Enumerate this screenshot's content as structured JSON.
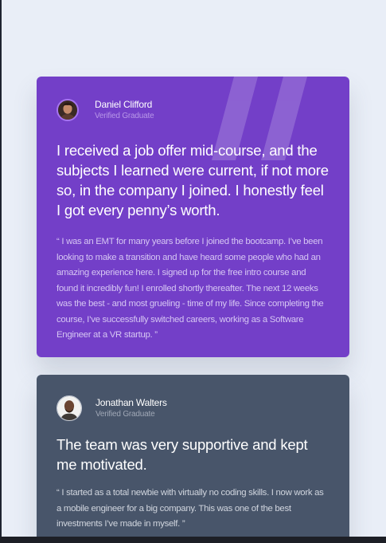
{
  "testimonials": [
    {
      "name": "Daniel Clifford",
      "role": "Verified Graduate",
      "headline": "I received a job offer mid-course, and the subjects I learned were current, if not more so, in the company I joined. I honestly feel I got every penny’s worth.",
      "quote": "“ I was an EMT for many years before I joined the bootcamp. I’ve been looking to make a transition and have heard some people who had an amazing experience here. I signed up for the free intro course and found it incredibly fun! I enrolled shortly thereafter. The next 12 weeks was the best - and most grueling - time of my life. Since completing the course, I’ve successfully switched careers, working as a Software Engineer at a VR startup. ”",
      "background": "#733fc8"
    },
    {
      "name": "Jonathan Walters",
      "role": "Verified Graduate",
      "headline": "The team was very supportive and kept me motivated.",
      "quote": "“ I started as a total newbie with virtually no coding skills. I now work as a mobile engineer for a big company. This was one of the best investments I’ve made in myself. ”",
      "background": "#48556a"
    }
  ],
  "icons": {
    "quote_mark": "quote-mark-icon",
    "avatar": "avatar"
  }
}
